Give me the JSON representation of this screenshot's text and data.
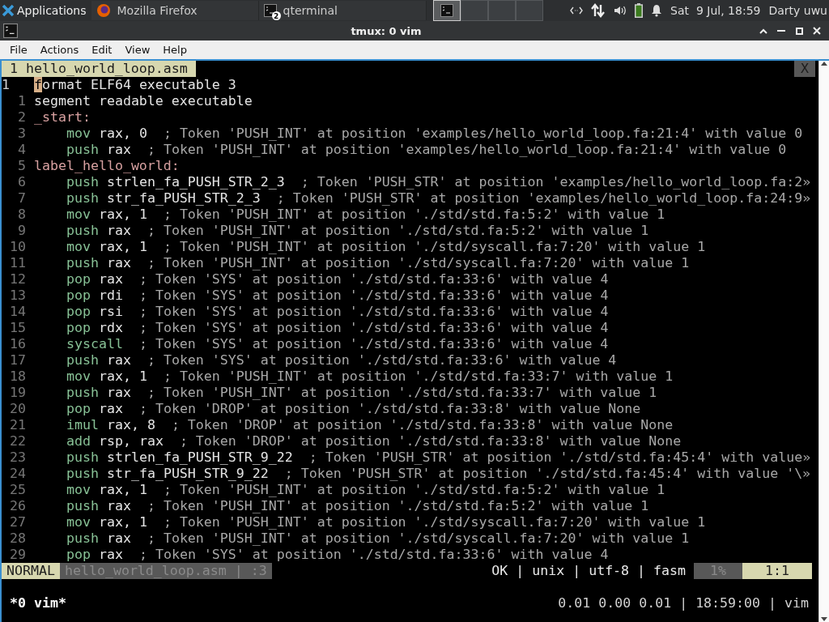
{
  "taskbar": {
    "apps_menu": "Applications",
    "tasks": [
      {
        "label": "Mozilla Firefox",
        "kind": "browser",
        "selected": false
      },
      {
        "label": "qterminal",
        "kind": "terminal",
        "badge": "2",
        "selected": false
      }
    ],
    "pager": [
      {
        "selected": true
      },
      {
        "selected": false
      },
      {
        "selected": false
      },
      {
        "selected": false
      }
    ],
    "clock": "Sat  9 Jul, 18:59",
    "user": "Darty uwu"
  },
  "window": {
    "title": "tmux: 0 vim",
    "menu": [
      "File",
      "Actions",
      "Edit",
      "View",
      "Help"
    ]
  },
  "vim": {
    "tabs": [
      {
        "label": "1 hello_world_loop.asm",
        "selected": true
      }
    ],
    "close_label": "X",
    "lines": [
      {
        "number": "1",
        "current": true,
        "kind": "plain",
        "cursor": "f",
        "text": "ormat ELF64 executable 3"
      },
      {
        "number": "1",
        "current": false,
        "kind": "plain",
        "text": "segment readable executable"
      },
      {
        "number": "2",
        "current": false,
        "kind": "label",
        "text": "_start:"
      },
      {
        "number": "3",
        "current": false,
        "kind": "instr",
        "keyword": "mov",
        "operand": " rax, 0",
        "comment": "  ; Token 'PUSH_INT' at position 'examples/hello_world_loop.fa:21:4' with value 0"
      },
      {
        "number": "4",
        "current": false,
        "kind": "instr",
        "keyword": "push",
        "operand": " rax",
        "comment": "  ; Token 'PUSH_INT' at position 'examples/hello_world_loop.fa:21:4' with value 0"
      },
      {
        "number": "5",
        "current": false,
        "kind": "label",
        "text": "label_hello_world:"
      },
      {
        "number": "6",
        "current": false,
        "kind": "instr",
        "keyword": "push",
        "operand": " strlen_fa_PUSH_STR_2_3",
        "comment": "  ; Token 'PUSH_STR' at position 'examples/hello_world_loop.fa:2»"
      },
      {
        "number": "7",
        "current": false,
        "kind": "instr",
        "keyword": "push",
        "operand": " str_fa_PUSH_STR_2_3",
        "comment": "  ; Token 'PUSH_STR' at position 'examples/hello_world_loop.fa:24:9»"
      },
      {
        "number": "8",
        "current": false,
        "kind": "instr",
        "keyword": "mov",
        "operand": " rax, 1",
        "comment": "  ; Token 'PUSH_INT' at position './std/std.fa:5:2' with value 1"
      },
      {
        "number": "9",
        "current": false,
        "kind": "instr",
        "keyword": "push",
        "operand": " rax",
        "comment": "  ; Token 'PUSH_INT' at position './std/std.fa:5:2' with value 1"
      },
      {
        "number": "10",
        "current": false,
        "kind": "instr",
        "keyword": "mov",
        "operand": " rax, 1",
        "comment": "  ; Token 'PUSH_INT' at position './std/syscall.fa:7:20' with value 1"
      },
      {
        "number": "11",
        "current": false,
        "kind": "instr",
        "keyword": "push",
        "operand": " rax",
        "comment": "  ; Token 'PUSH_INT' at position './std/syscall.fa:7:20' with value 1"
      },
      {
        "number": "12",
        "current": false,
        "kind": "instr",
        "keyword": "pop",
        "operand": " rax",
        "comment": "  ; Token 'SYS' at position './std/std.fa:33:6' with value 4"
      },
      {
        "number": "13",
        "current": false,
        "kind": "instr",
        "keyword": "pop",
        "operand": " rdi",
        "comment": "  ; Token 'SYS' at position './std/std.fa:33:6' with value 4"
      },
      {
        "number": "14",
        "current": false,
        "kind": "instr",
        "keyword": "pop",
        "operand": " rsi",
        "comment": "  ; Token 'SYS' at position './std/std.fa:33:6' with value 4"
      },
      {
        "number": "15",
        "current": false,
        "kind": "instr",
        "keyword": "pop",
        "operand": " rdx",
        "comment": "  ; Token 'SYS' at position './std/std.fa:33:6' with value 4"
      },
      {
        "number": "16",
        "current": false,
        "kind": "instr",
        "keyword": "syscall",
        "comment": "  ; Token 'SYS' at position './std/std.fa:33:6' with value 4"
      },
      {
        "number": "17",
        "current": false,
        "kind": "instr",
        "keyword": "push",
        "operand": " rax",
        "comment": "  ; Token 'SYS' at position './std/std.fa:33:6' with value 4"
      },
      {
        "number": "18",
        "current": false,
        "kind": "instr",
        "keyword": "mov",
        "operand": " rax, 1",
        "comment": "  ; Token 'PUSH_INT' at position './std/std.fa:33:7' with value 1"
      },
      {
        "number": "19",
        "current": false,
        "kind": "instr",
        "keyword": "push",
        "operand": " rax",
        "comment": "  ; Token 'PUSH_INT' at position './std/std.fa:33:7' with value 1"
      },
      {
        "number": "20",
        "current": false,
        "kind": "instr",
        "keyword": "pop",
        "operand": " rax",
        "comment": "  ; Token 'DROP' at position './std/std.fa:33:8' with value None"
      },
      {
        "number": "21",
        "current": false,
        "kind": "instr",
        "keyword": "imul",
        "operand": " rax, 8",
        "comment": "  ; Token 'DROP' at position './std/std.fa:33:8' with value None"
      },
      {
        "number": "22",
        "current": false,
        "kind": "instr",
        "keyword": "add",
        "operand": " rsp, rax",
        "comment": "  ; Token 'DROP' at position './std/std.fa:33:8' with value None"
      },
      {
        "number": "23",
        "current": false,
        "kind": "instr",
        "keyword": "push",
        "operand": " strlen_fa_PUSH_STR_9_22",
        "comment": "  ; Token 'PUSH_STR' at position './std/std.fa:45:4' with value»"
      },
      {
        "number": "24",
        "current": false,
        "kind": "instr",
        "keyword": "push",
        "operand": " str_fa_PUSH_STR_9_22",
        "comment": "  ; Token 'PUSH_STR' at position './std/std.fa:45:4' with value '\\»"
      },
      {
        "number": "25",
        "current": false,
        "kind": "instr",
        "keyword": "mov",
        "operand": " rax, 1",
        "comment": "  ; Token 'PUSH_INT' at position './std/std.fa:5:2' with value 1"
      },
      {
        "number": "26",
        "current": false,
        "kind": "instr",
        "keyword": "push",
        "operand": " rax",
        "comment": "  ; Token 'PUSH_INT' at position './std/std.fa:5:2' with value 1"
      },
      {
        "number": "27",
        "current": false,
        "kind": "instr",
        "keyword": "mov",
        "operand": " rax, 1",
        "comment": "  ; Token 'PUSH_INT' at position './std/syscall.fa:7:20' with value 1"
      },
      {
        "number": "28",
        "current": false,
        "kind": "instr",
        "keyword": "push",
        "operand": " rax",
        "comment": "  ; Token 'PUSH_INT' at position './std/syscall.fa:7:20' with value 1"
      },
      {
        "number": "29",
        "current": false,
        "kind": "instr",
        "keyword": "pop",
        "operand": " rax",
        "comment": "  ; Token 'SYS' at position './std/std.fa:33:6' with value 4"
      }
    ],
    "statusline": {
      "mode": "NORMAL",
      "file": "hello_world_loop.asm | :3",
      "info": "OK | unix | utf-8 | fasm",
      "percent": "1%",
      "position": "1:1"
    }
  },
  "tmux": {
    "windows": "*0 vim*",
    "status_right": "0.01 0.00 0.01 | 18:59:00 | vim"
  }
}
